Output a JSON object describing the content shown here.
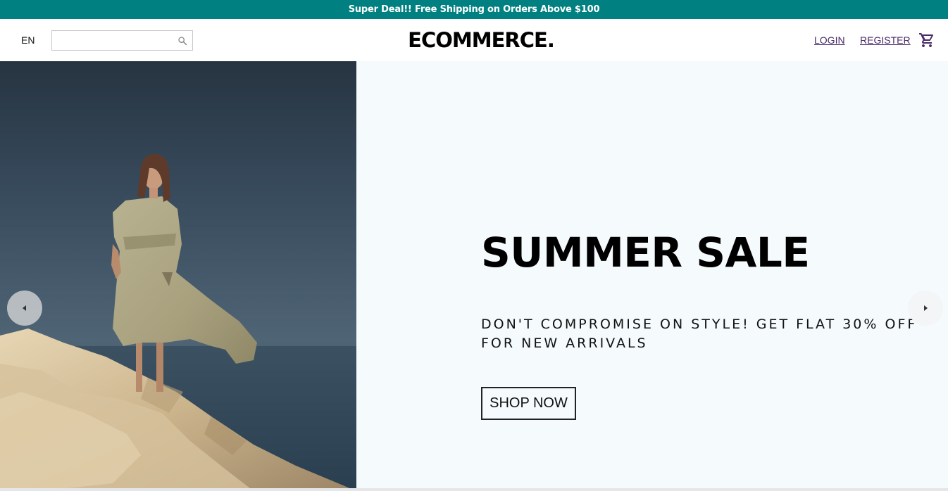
{
  "announcement": {
    "text": "Super Deal!! Free Shipping on Orders Above $100",
    "background_color": "#008080"
  },
  "navbar": {
    "language": "EN",
    "search": {
      "value": "",
      "placeholder": "",
      "icon": "search-icon"
    },
    "logo": "ECOMMERCE.",
    "links": {
      "login": "LOGIN",
      "register": "REGISTER"
    },
    "cart_icon": "shopping-cart-icon",
    "link_color": "#4a2a6a"
  },
  "slider": {
    "background_color": "#f5fafd",
    "image_description_icon": "hero-photo",
    "title": "SUMMER SALE",
    "description": "DON'T COMPROMISE ON STYLE! GET FLAT 30% OFF FOR NEW ARRIVALS",
    "button_label": "SHOP NOW",
    "prev_icon": "arrow-left-icon",
    "next_icon": "arrow-right-icon"
  }
}
